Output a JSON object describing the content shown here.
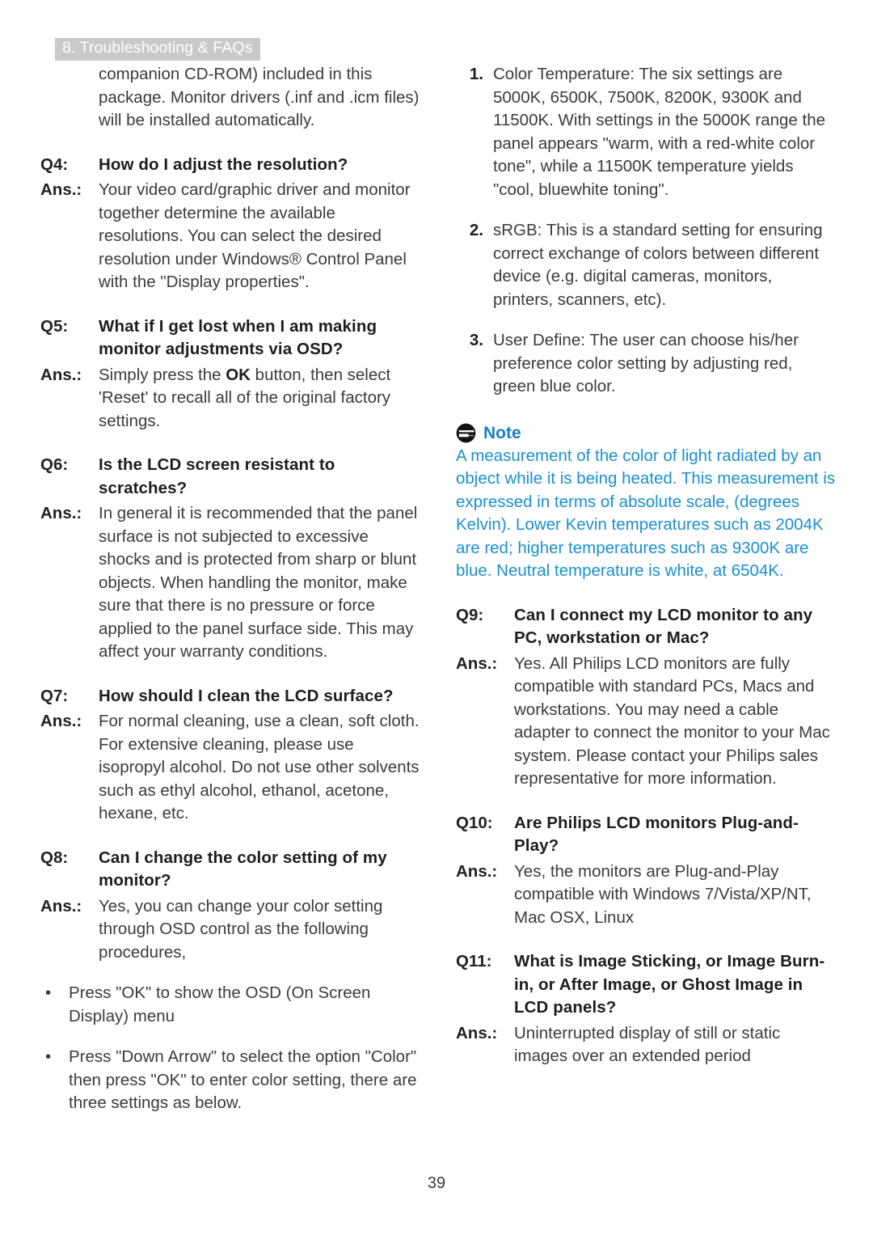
{
  "header": {
    "chapter_label": "8. Troubleshooting & FAQs"
  },
  "left_column": {
    "continued_paragraph": "companion CD-ROM) included in this package. Monitor drivers (.inf and .icm files) will be installed automatically.",
    "qa": [
      {
        "q_label": "Q4:",
        "question": "How do I adjust the resolution?",
        "a_label": "Ans.:",
        "answer": "Your video card/graphic driver and monitor together determine the available resolutions. You can select the desired resolution under Windows® Control Panel with the \"Display properties\"."
      },
      {
        "q_label": "Q5:",
        "question": "What if I get lost when I am making monitor adjustments via OSD?",
        "a_label": "Ans.:",
        "answer_pre": "Simply press the ",
        "answer_strong": "OK",
        "answer_post": " button, then select 'Reset' to recall all of the original factory settings."
      },
      {
        "q_label": "Q6:",
        "question": "Is the LCD screen resistant to scratches?",
        "a_label": "Ans.:",
        "answer": "In general it is recommended that the panel surface is not subjected to excessive shocks and is protected from sharp or blunt objects. When handling the monitor, make sure that there is no pressure or force applied to the panel surface side. This may affect your warranty conditions."
      },
      {
        "q_label": "Q7:",
        "question": "How should I clean the LCD surface?",
        "a_label": "Ans.:",
        "answer": "For normal cleaning, use a clean, soft cloth. For extensive cleaning, please use isopropyl alcohol. Do not use other solvents such as ethyl alcohol, ethanol, acetone, hexane, etc."
      },
      {
        "q_label": "Q8:",
        "question": "Can I change the color setting of my monitor?",
        "a_label": "Ans.:",
        "answer": "Yes, you can change your color setting through OSD control as the following procedures,"
      }
    ],
    "bullet_mark": "•",
    "bullets": [
      "Press \"OK\" to show the OSD (On Screen Display) menu",
      "Press \"Down Arrow\" to select the option \"Color\" then press \"OK\" to enter color setting, there are three settings as below."
    ]
  },
  "right_column": {
    "numbered_items": [
      {
        "marker": "1.",
        "text": "Color Temperature: The six settings are 5000K, 6500K, 7500K, 8200K, 9300K and 11500K. With settings in the 5000K range the panel appears \"warm, with a red-white color tone\", while a 11500K temperature yields \"cool, bluewhite toning\"."
      },
      {
        "marker": "2.",
        "text": "sRGB: This is a standard setting for ensuring correct exchange of colors between different device (e.g. digital cameras, monitors, printers, scanners, etc)."
      },
      {
        "marker": "3.",
        "text": "User Define: The user can choose his/her preference color setting by adjusting red, green blue color."
      }
    ],
    "note": {
      "icon": "note-icon",
      "title": "Note",
      "body": "A measurement of the color of light radiated by an object while it is being heated. This measurement is expressed in terms of absolute scale, (degrees Kelvin). Lower Kevin temperatures such as 2004K are red; higher temperatures such as 9300K are blue. Neutral temperature is white, at 6504K."
    },
    "qa": [
      {
        "q_label": "Q9:",
        "question": "Can I connect my LCD monitor to any PC, workstation or Mac?",
        "a_label": "Ans.:",
        "answer": "Yes. All Philips LCD monitors are fully compatible with standard PCs, Macs and workstations. You may need a cable adapter to connect the monitor to your Mac system. Please contact your Philips sales representative for more information."
      },
      {
        "q_label": "Q10:",
        "question": "Are Philips LCD monitors Plug-and-Play?",
        "a_label": "Ans.:",
        "answer": "Yes, the monitors are Plug-and-Play compatible with Windows 7/Vista/XP/NT, Mac OSX, Linux"
      },
      {
        "q_label": "Q11:",
        "question": "What is Image Sticking, or Image Burn-in, or After Image, or Ghost Image in LCD panels?",
        "a_label": "Ans.:",
        "answer": "Uninterrupted display of still or static images over an extended period"
      }
    ]
  },
  "footer": {
    "page_number": "39"
  },
  "colors": {
    "header_background": "#c9c9c9",
    "header_text": "#ffffff",
    "body_text": "#3b3b3b",
    "heading_text": "#1d1d1d",
    "note_title": "#1a7fc1",
    "note_body": "#1a8fd0"
  }
}
